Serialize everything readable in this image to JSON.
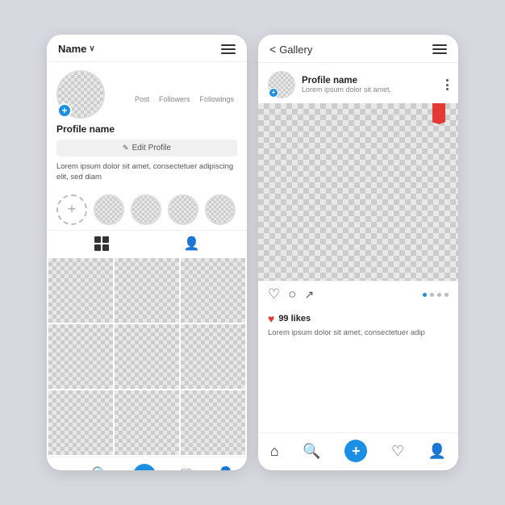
{
  "left_phone": {
    "top_bar": {
      "title": "Name",
      "chevron": "∨",
      "hamburger_label": "menu"
    },
    "profile": {
      "stats": [
        {
          "num": "",
          "label": "Post"
        },
        {
          "num": "",
          "label": "Followers"
        },
        {
          "num": "",
          "label": "Followings"
        }
      ],
      "name": "Profile name",
      "edit_button": "Edit Profile",
      "bio": "Lorem ipsum dolor sit amet, consectetuer adipiscing elit, sed diam"
    },
    "stories": [
      "add",
      "circle",
      "circle",
      "circle",
      "circle"
    ],
    "view_toggle": [
      "grid",
      "person"
    ],
    "bottom_nav": [
      "home",
      "search",
      "add",
      "heart",
      "person"
    ]
  },
  "right_phone": {
    "top_bar": {
      "back": "<",
      "title": "Gallery",
      "hamburger_label": "menu"
    },
    "profile": {
      "name": "Profile name",
      "subtitle": "Lorem ipsum dolor sit amet,"
    },
    "action_icons": [
      "heart-outline",
      "comment",
      "share"
    ],
    "dots": [
      true,
      false,
      false,
      false
    ],
    "likes": {
      "count": "99 likes",
      "caption": "Lorem ipsum dolor sit amet, consectetuer adip"
    },
    "bottom_nav": [
      "home",
      "search",
      "add",
      "heart",
      "person"
    ]
  },
  "colors": {
    "blue": "#1a8fe3",
    "red": "#e53935",
    "bg": "#d8d8e0"
  }
}
